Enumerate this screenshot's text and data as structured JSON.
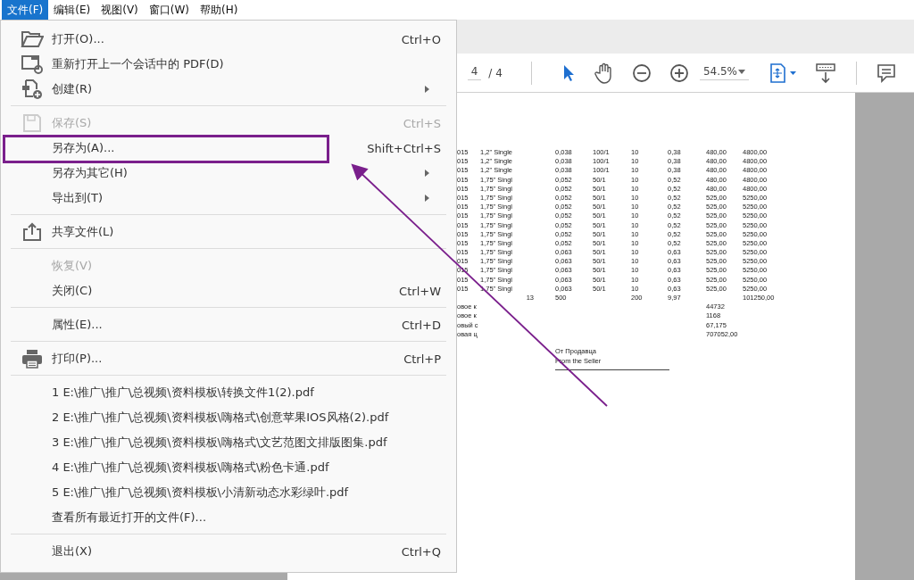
{
  "menubar": [
    {
      "label": "文件(F)",
      "selected": true
    },
    {
      "label": "编辑(E)",
      "selected": false
    },
    {
      "label": "视图(V)",
      "selected": false
    },
    {
      "label": "窗口(W)",
      "selected": false
    },
    {
      "label": "帮助(H)",
      "selected": false
    }
  ],
  "file_menu": [
    {
      "kind": "command",
      "label": "打开(O)...",
      "shortcut": "Ctrl+O",
      "disabled": false,
      "submenu": false,
      "highlighted": false
    },
    {
      "kind": "command",
      "label": "重新打开上一个会话中的 PDF(D)",
      "disabled": false,
      "submenu": false,
      "highlighted": false
    },
    {
      "kind": "command",
      "label": "创建(R)",
      "disabled": false,
      "submenu": true,
      "highlighted": false
    },
    {
      "kind": "separator"
    },
    {
      "kind": "command",
      "label": "保存(S)",
      "shortcut": "Ctrl+S",
      "disabled": true,
      "submenu": false,
      "highlighted": false
    },
    {
      "kind": "command",
      "label": "另存为(A)...",
      "shortcut": "Shift+Ctrl+S",
      "disabled": false,
      "submenu": false,
      "highlighted": true
    },
    {
      "kind": "command",
      "label": "另存为其它(H)",
      "disabled": false,
      "submenu": true,
      "highlighted": false
    },
    {
      "kind": "command",
      "label": "导出到(T)",
      "disabled": false,
      "submenu": true,
      "highlighted": false
    },
    {
      "kind": "separator"
    },
    {
      "kind": "command",
      "label": "共享文件(L)",
      "disabled": false,
      "submenu": false,
      "highlighted": false
    },
    {
      "kind": "separator"
    },
    {
      "kind": "command",
      "label": "恢复(V)",
      "disabled": true,
      "submenu": false,
      "highlighted": false
    },
    {
      "kind": "command",
      "label": "关闭(C)",
      "shortcut": "Ctrl+W",
      "disabled": false,
      "submenu": false,
      "highlighted": false
    },
    {
      "kind": "separator"
    },
    {
      "kind": "command",
      "label": "属性(E)...",
      "shortcut": "Ctrl+D",
      "disabled": false,
      "submenu": false,
      "highlighted": false
    },
    {
      "kind": "separator"
    },
    {
      "kind": "command",
      "label": "打印(P)...",
      "shortcut": "Ctrl+P",
      "disabled": false,
      "submenu": false,
      "highlighted": false
    },
    {
      "kind": "separator"
    },
    {
      "kind": "command",
      "label": "1 E:\\推广\\推广\\总视频\\资料模板\\转换文件1(2).pdf",
      "disabled": false,
      "submenu": false,
      "highlighted": false
    },
    {
      "kind": "command",
      "label": "2 E:\\推广\\推广\\总视频\\资料模板\\嗨格式\\创意苹果IOS风格(2).pdf",
      "disabled": false,
      "submenu": false,
      "highlighted": false
    },
    {
      "kind": "command",
      "label": "3 E:\\推广\\推广\\总视频\\资料模板\\嗨格式\\文艺范图文排版图集.pdf",
      "disabled": false,
      "submenu": false,
      "highlighted": false
    },
    {
      "kind": "command",
      "label": "4 E:\\推广\\推广\\总视频\\资料模板\\嗨格式\\粉色卡通.pdf",
      "disabled": false,
      "submenu": false,
      "highlighted": false
    },
    {
      "kind": "command",
      "label": "5 E:\\推广\\推广\\总视频\\资料模板\\小清新动态水彩绿叶.pdf",
      "disabled": false,
      "submenu": false,
      "highlighted": false
    },
    {
      "kind": "command",
      "label": "查看所有最近打开的文件(F)...",
      "disabled": false,
      "submenu": false,
      "highlighted": false
    },
    {
      "kind": "separator"
    },
    {
      "kind": "command",
      "label": "退出(X)",
      "shortcut": "Ctrl+Q",
      "disabled": false,
      "submenu": false,
      "highlighted": false
    }
  ],
  "toolbar": {
    "page": "4",
    "page_count": "/ 4",
    "zoom": "54.5%"
  },
  "document": {
    "rows": [
      {
        "column_1": "015",
        "column_2": "1,2\" Single",
        "column_3": "0,038",
        "column_4": "100/1",
        "column_5": "10",
        "column_6": "0,38",
        "column_7": "480,00",
        "column_8": "4800,00"
      },
      {
        "column_1": "015",
        "column_2": "1,2\" Single",
        "column_3": "0,038",
        "column_4": "100/1",
        "column_5": "10",
        "column_6": "0,38",
        "column_7": "480,00",
        "column_8": "4800,00"
      },
      {
        "column_1": "015",
        "column_2": "1,2\" Single",
        "column_3": "0,038",
        "column_4": "100/1",
        "column_5": "10",
        "column_6": "0,38",
        "column_7": "480,00",
        "column_8": "4800,00"
      },
      {
        "column_1": "015",
        "column_2": "1,75\" Singl",
        "column_3": "0,052",
        "column_4": "50/1",
        "column_5": "10",
        "column_6": "0,52",
        "column_7": "480,00",
        "column_8": "4800,00"
      },
      {
        "column_1": "015",
        "column_2": "1,75\" Singl",
        "column_3": "0,052",
        "column_4": "50/1",
        "column_5": "10",
        "column_6": "0,52",
        "column_7": "480,00",
        "column_8": "4800,00"
      },
      {
        "column_1": "015",
        "column_2": "1,75\" Singl",
        "column_3": "0,052",
        "column_4": "50/1",
        "column_5": "10",
        "column_6": "0,52",
        "column_7": "525,00",
        "column_8": "5250,00"
      },
      {
        "column_1": "015",
        "column_2": "1,75\" Singl",
        "column_3": "0,052",
        "column_4": "50/1",
        "column_5": "10",
        "column_6": "0,52",
        "column_7": "525,00",
        "column_8": "5250,00"
      },
      {
        "column_1": "015",
        "column_2": "1,75\" Singl",
        "column_3": "0,052",
        "column_4": "50/1",
        "column_5": "10",
        "column_6": "0,52",
        "column_7": "525,00",
        "column_8": "5250,00"
      },
      {
        "column_1": "015",
        "column_2": "1,75\" Singl",
        "column_3": "0,052",
        "column_4": "50/1",
        "column_5": "10",
        "column_6": "0,52",
        "column_7": "525,00",
        "column_8": "5250,00"
      },
      {
        "column_1": "015",
        "column_2": "1,75\" Singl",
        "column_3": "0,052",
        "column_4": "50/1",
        "column_5": "10",
        "column_6": "0,52",
        "column_7": "525,00",
        "column_8": "5250,00"
      },
      {
        "column_1": "015",
        "column_2": "1,75\" Singl",
        "column_3": "0,052",
        "column_4": "50/1",
        "column_5": "10",
        "column_6": "0,52",
        "column_7": "525,00",
        "column_8": "5250,00"
      },
      {
        "column_1": "015",
        "column_2": "1,75\" Singl",
        "column_3": "0,063",
        "column_4": "50/1",
        "column_5": "10",
        "column_6": "0,63",
        "column_7": "525,00",
        "column_8": "5250,00"
      },
      {
        "column_1": "015",
        "column_2": "1,75\" Singl",
        "column_3": "0,063",
        "column_4": "50/1",
        "column_5": "10",
        "column_6": "0,63",
        "column_7": "525,00",
        "column_8": "5250,00"
      },
      {
        "column_1": "015",
        "column_2": "1,75\" Singl",
        "column_3": "0,063",
        "column_4": "50/1",
        "column_5": "10",
        "column_6": "0,63",
        "column_7": "525,00",
        "column_8": "5250,00"
      },
      {
        "column_1": "015",
        "column_2": "1,75\" Singl",
        "column_3": "0,063",
        "column_4": "50/1",
        "column_5": "10",
        "column_6": "0,63",
        "column_7": "525,00",
        "column_8": "5250,00"
      },
      {
        "column_1": "015",
        "column_2": "1,75\" Singl",
        "column_3": "0,063",
        "column_4": "50/1",
        "column_5": "10",
        "column_6": "0,63",
        "column_7": "525,00",
        "column_8": "5250,00"
      },
      {
        "column_2": "13",
        "column_3": "500",
        "column_5": "200",
        "column_6": "9,97",
        "column_8": "101250,00"
      },
      {
        "column_1": "овое к",
        "column_7": "44732"
      },
      {
        "column_1": "овое к",
        "column_7": "1168"
      },
      {
        "column_1": "овый с",
        "column_7": "67,175"
      },
      {
        "column_1": "овая ц",
        "column_7": "707052,00"
      }
    ],
    "signature": [
      "От Продавца",
      "From the Seller"
    ]
  }
}
